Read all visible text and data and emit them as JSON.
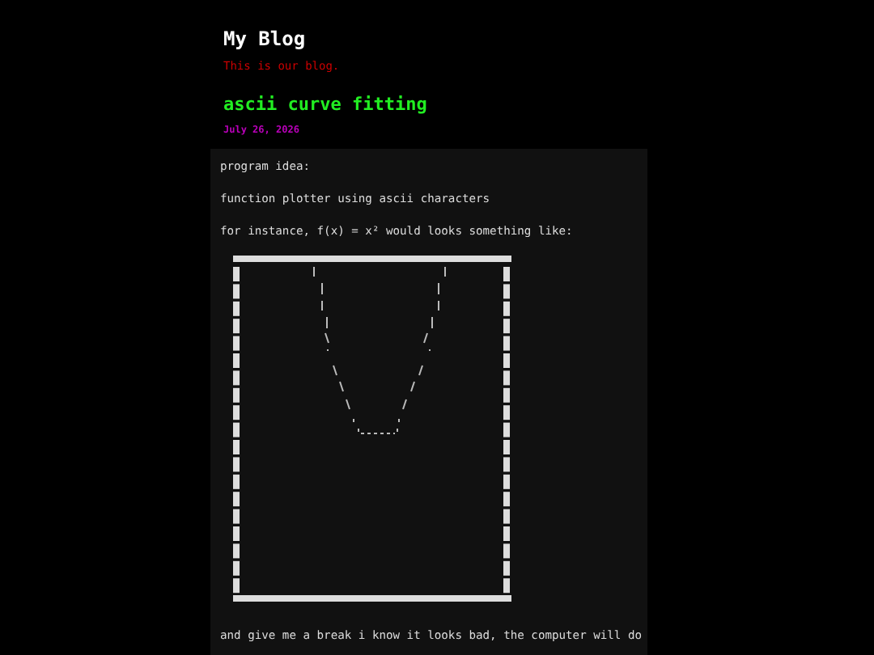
{
  "blog": {
    "title": "My Blog",
    "tagline": "This is our blog."
  },
  "post": {
    "title": "ascii curve fitting",
    "date": "July 26, 2026",
    "paragraphs_before": [
      "program idea:",
      "function plotter using ascii characters",
      "for instance, f(x) = x² would looks something like:"
    ],
    "paragraphs_after": [
      "and give me a break i know it looks bad, the computer will do"
    ]
  }
}
